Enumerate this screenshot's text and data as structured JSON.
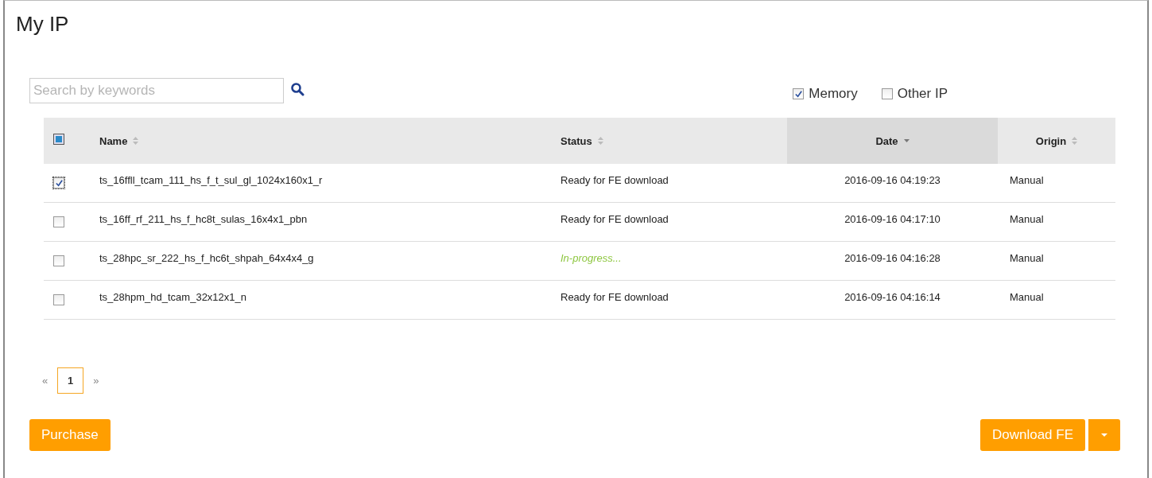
{
  "page": {
    "title": "My IP"
  },
  "search": {
    "placeholder": "Search by keywords"
  },
  "filters": [
    {
      "label": "Memory",
      "checked": true
    },
    {
      "label": "Other IP",
      "checked": false
    }
  ],
  "table": {
    "select_all": {
      "checked": false,
      "indeterminate": true
    },
    "columns": [
      {
        "label": "Name",
        "sorted": false,
        "selected": false,
        "centered": false
      },
      {
        "label": "Status",
        "sorted": false,
        "selected": false,
        "centered": false
      },
      {
        "label": "Date",
        "sorted": true,
        "selected": true,
        "centered": true
      },
      {
        "label": "Origin",
        "sorted": false,
        "selected": false,
        "centered": true
      }
    ],
    "rows": [
      {
        "checked": true,
        "name": "ts_16ffll_tcam_111_hs_f_t_sul_gl_1024x160x1_r",
        "status": "Ready for FE download",
        "in_progress": false,
        "date": "2016-09-16 04:19:23",
        "origin": "Manual"
      },
      {
        "checked": false,
        "name": "ts_16ff_rf_211_hs_f_hc8t_sulas_16x4x1_pbn",
        "status": "Ready for FE download",
        "in_progress": false,
        "date": "2016-09-16 04:17:10",
        "origin": "Manual"
      },
      {
        "checked": false,
        "name": "ts_28hpc_sr_222_hs_f_hc6t_shpah_64x4x4_g",
        "status": "In-progress...",
        "in_progress": true,
        "date": "2016-09-16 04:16:28",
        "origin": "Manual"
      },
      {
        "checked": false,
        "name": "ts_28hpm_hd_tcam_32x12x1_n",
        "status": "Ready for FE download",
        "in_progress": false,
        "date": "2016-09-16 04:16:14",
        "origin": "Manual"
      }
    ]
  },
  "pagination": {
    "prev": "«",
    "next": "»",
    "pages": [
      {
        "label": "1",
        "selected": true
      }
    ]
  },
  "buttons": {
    "purchase": "Purchase",
    "download": "Download FE"
  }
}
